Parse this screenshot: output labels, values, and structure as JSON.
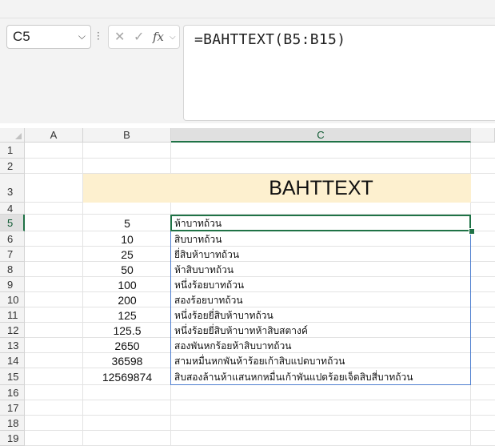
{
  "name_box": {
    "value": "C5"
  },
  "formula_bar": {
    "cancel_glyph": "✕",
    "enter_glyph": "✓",
    "fx_glyph": "fx",
    "formula": "=BAHTTEXT(B5:B15)"
  },
  "columns": [
    "A",
    "B",
    "C"
  ],
  "rows": [
    "1",
    "2",
    "3",
    "4",
    "5",
    "6",
    "7",
    "8",
    "9",
    "10",
    "11",
    "12",
    "13",
    "14",
    "15",
    "16",
    "17",
    "18",
    "19"
  ],
  "title": "BAHTTEXT",
  "data": [
    {
      "row": "5",
      "number": "5",
      "text": "ห้าบาทถ้วน"
    },
    {
      "row": "6",
      "number": "10",
      "text": "สิบบาทถ้วน"
    },
    {
      "row": "7",
      "number": "25",
      "text": "ยี่สิบห้าบาทถ้วน"
    },
    {
      "row": "8",
      "number": "50",
      "text": "ห้าสิบบาทถ้วน"
    },
    {
      "row": "9",
      "number": "100",
      "text": "หนึ่งร้อยบาทถ้วน"
    },
    {
      "row": "10",
      "number": "200",
      "text": "สองร้อยบาทถ้วน"
    },
    {
      "row": "11",
      "number": "125",
      "text": "หนึ่งร้อยยี่สิบห้าบาทถ้วน"
    },
    {
      "row": "12",
      "number": "125.5",
      "text": "หนึ่งร้อยยี่สิบห้าบาทห้าสิบสตางค์"
    },
    {
      "row": "13",
      "number": "2650",
      "text": "สองพันหกร้อยห้าสิบบาทถ้วน"
    },
    {
      "row": "14",
      "number": "36598",
      "text": "สามหมื่นหกพันห้าร้อยเก้าสิบแปดบาทถ้วน"
    },
    {
      "row": "15",
      "number": "12569874",
      "text": "สิบสองล้านห้าแสนหกหมื่นเก้าพันแปดร้อยเจ็ดสิบสี่บาทถ้วน"
    }
  ],
  "colors": {
    "accent": "#1f7246",
    "title_fill": "#fdf0cf",
    "spill_border": "#4f7fd0"
  }
}
